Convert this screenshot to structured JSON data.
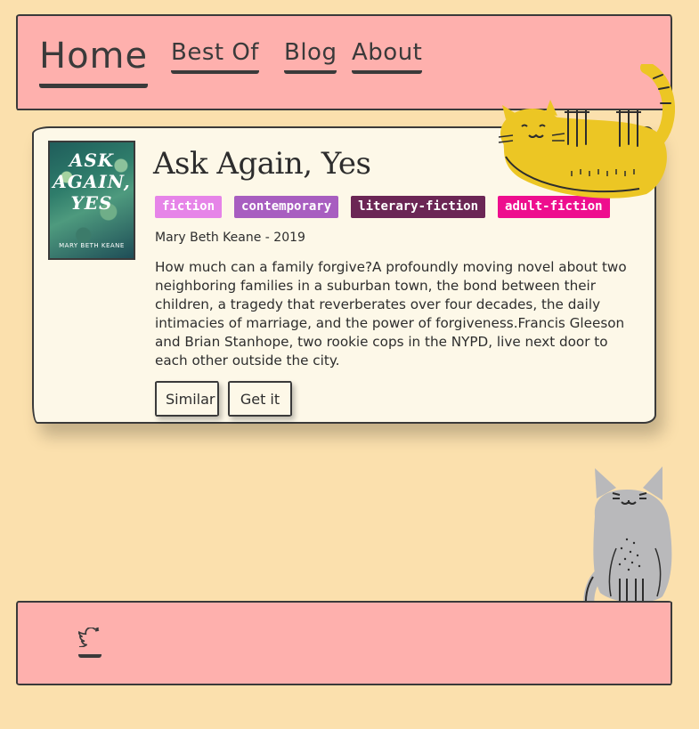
{
  "nav": {
    "home": "Home",
    "best_of": "Best Of",
    "blog": "Blog",
    "about": "About"
  },
  "book": {
    "cover": {
      "title_line1": "ASK",
      "title_line2": "AGAIN,",
      "title_line3": "YES",
      "author": "MARY BETH KEANE"
    },
    "title": "Ask Again, Yes",
    "tags": [
      {
        "label": "fiction",
        "color": "#e684e8"
      },
      {
        "label": "contemporary",
        "color": "#a85ec0"
      },
      {
        "label": "literary-fiction",
        "color": "#6b2655"
      },
      {
        "label": "adult-fiction",
        "color": "#ee0e8e"
      }
    ],
    "meta": "Mary Beth Keane - 2019",
    "description": "How much can a family forgive?A profoundly moving novel about two neighboring families in a suburban town, the bond between their children, a tragedy that reverberates over four decades, the daily intimacies of marriage, and the power of forgiveness.Francis Gleeson and Brian Stanhope, two rookie cops in the NYPD, live next door to each other outside the city.",
    "buttons": {
      "similar": "Similar",
      "get_it": "Get it"
    }
  },
  "footer": {
    "icon": "twitter-icon"
  },
  "colors": {
    "page_bg": "#fbe0ad",
    "panel_bg": "#feb0ad",
    "card_bg": "#fdf8e8",
    "ink": "#3a3a3a",
    "cat_yellow": "#ecc624",
    "cat_gray": "#b9b9bb"
  }
}
